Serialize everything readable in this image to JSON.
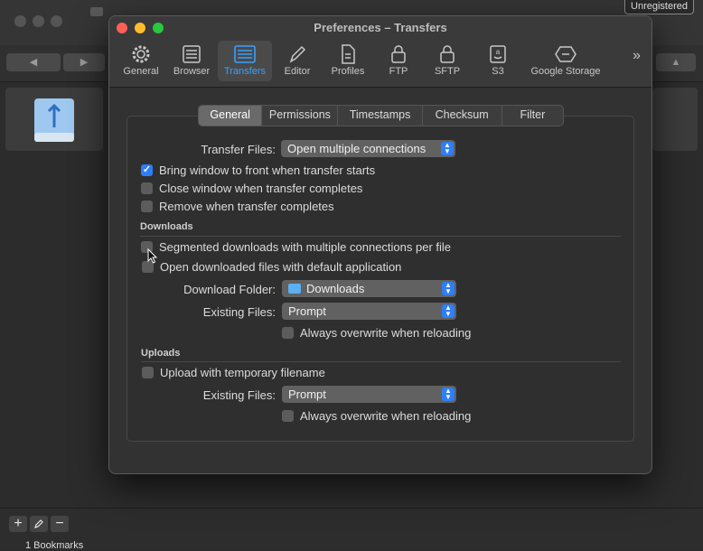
{
  "app": {
    "unregistered_label": "Unregistered",
    "bookmarks_count": "1 Bookmarks",
    "bottom_buttons": [
      "+",
      "−"
    ]
  },
  "window": {
    "title": "Preferences – Transfers",
    "colors": {
      "close": "#ff5f57",
      "minimize": "#febc2e",
      "zoom": "#28c840",
      "accent": "#2d7ff9"
    }
  },
  "toolbar": {
    "items": [
      {
        "label": "General",
        "icon": "gear-icon"
      },
      {
        "label": "Browser",
        "icon": "list-icon"
      },
      {
        "label": "Transfers",
        "icon": "transfers-icon",
        "selected": true
      },
      {
        "label": "Editor",
        "icon": "pencil-icon"
      },
      {
        "label": "Profiles",
        "icon": "profiles-icon"
      },
      {
        "label": "FTP",
        "icon": "lock-icon"
      },
      {
        "label": "SFTP",
        "icon": "lock-icon"
      },
      {
        "label": "S3",
        "icon": "amazon-icon"
      },
      {
        "label": "Google Storage",
        "icon": "google-storage-icon"
      }
    ],
    "more": "»"
  },
  "tabs": [
    "General",
    "Permissions",
    "Timestamps",
    "Checksum",
    "Filter"
  ],
  "general": {
    "transfer_files_label": "Transfer Files:",
    "transfer_files_value": "Open multiple connections",
    "bring_to_front": {
      "label": "Bring window to front when transfer starts",
      "checked": true
    },
    "close_window": {
      "label": "Close window when transfer completes",
      "checked": false
    },
    "remove_when_complete": {
      "label": "Remove when transfer completes",
      "checked": false
    }
  },
  "downloads": {
    "heading": "Downloads",
    "segmented": {
      "label": "Segmented downloads with multiple connections per file",
      "checked": false
    },
    "open_default": {
      "label": "Open downloaded files with default application",
      "checked": false
    },
    "folder_label": "Download Folder:",
    "folder_value": "Downloads",
    "existing_label": "Existing Files:",
    "existing_value": "Prompt",
    "always_overwrite": {
      "label": "Always overwrite when reloading",
      "checked": false
    }
  },
  "uploads": {
    "heading": "Uploads",
    "temp_filename": {
      "label": "Upload with temporary filename",
      "checked": false
    },
    "existing_label": "Existing Files:",
    "existing_value": "Prompt",
    "always_overwrite": {
      "label": "Always overwrite when reloading",
      "checked": false
    }
  }
}
